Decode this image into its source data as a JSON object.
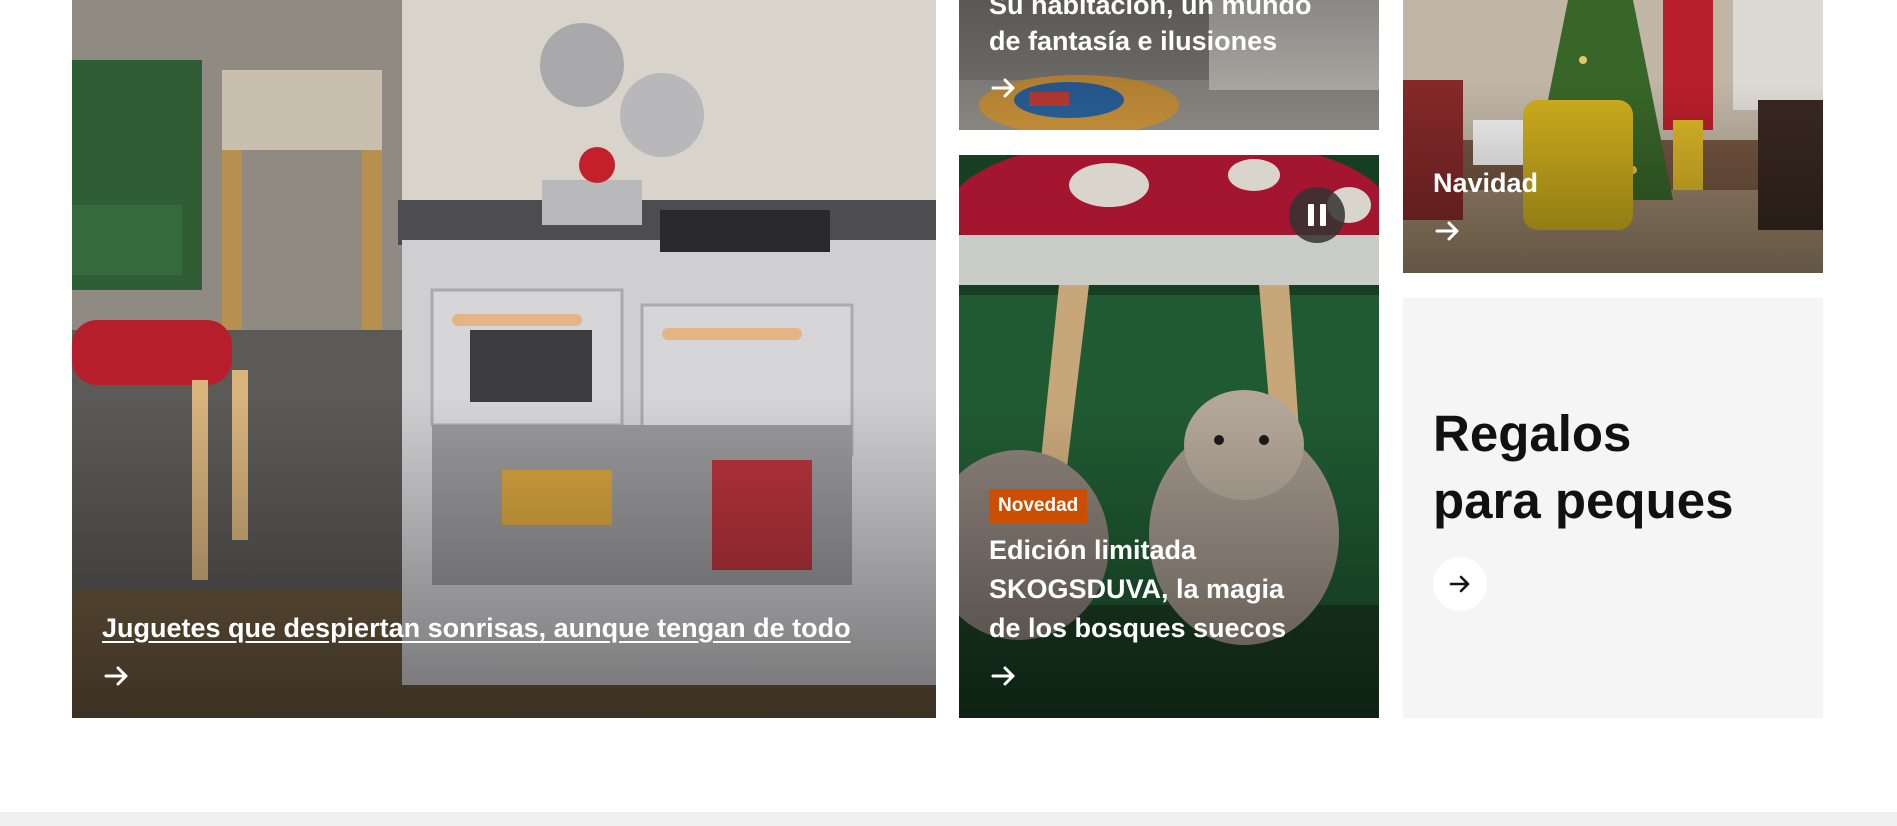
{
  "cards": {
    "juguetes": {
      "title": "Juguetes que despiertan sonrisas, aunque tengan de todo"
    },
    "habitacion": {
      "title_line1": "Su habitación, un mundo",
      "title_line2": "de fantasía e ilusiones"
    },
    "skogsduva": {
      "badge": "Novedad",
      "title_line1": "Edición limitada",
      "title_line2": "SKOGSDUVA, la magia",
      "title_line3": "de los bosques suecos"
    },
    "navidad": {
      "title": "Navidad"
    },
    "regalos": {
      "title_line1": "Regalos",
      "title_line2": "para peques"
    }
  },
  "icons": {
    "arrow": "arrow-right-icon",
    "pause": "pause-icon"
  },
  "colors": {
    "badge": "#cc4e00",
    "regalos_bg": "#f5f5f5",
    "dark_text": "#111111"
  }
}
